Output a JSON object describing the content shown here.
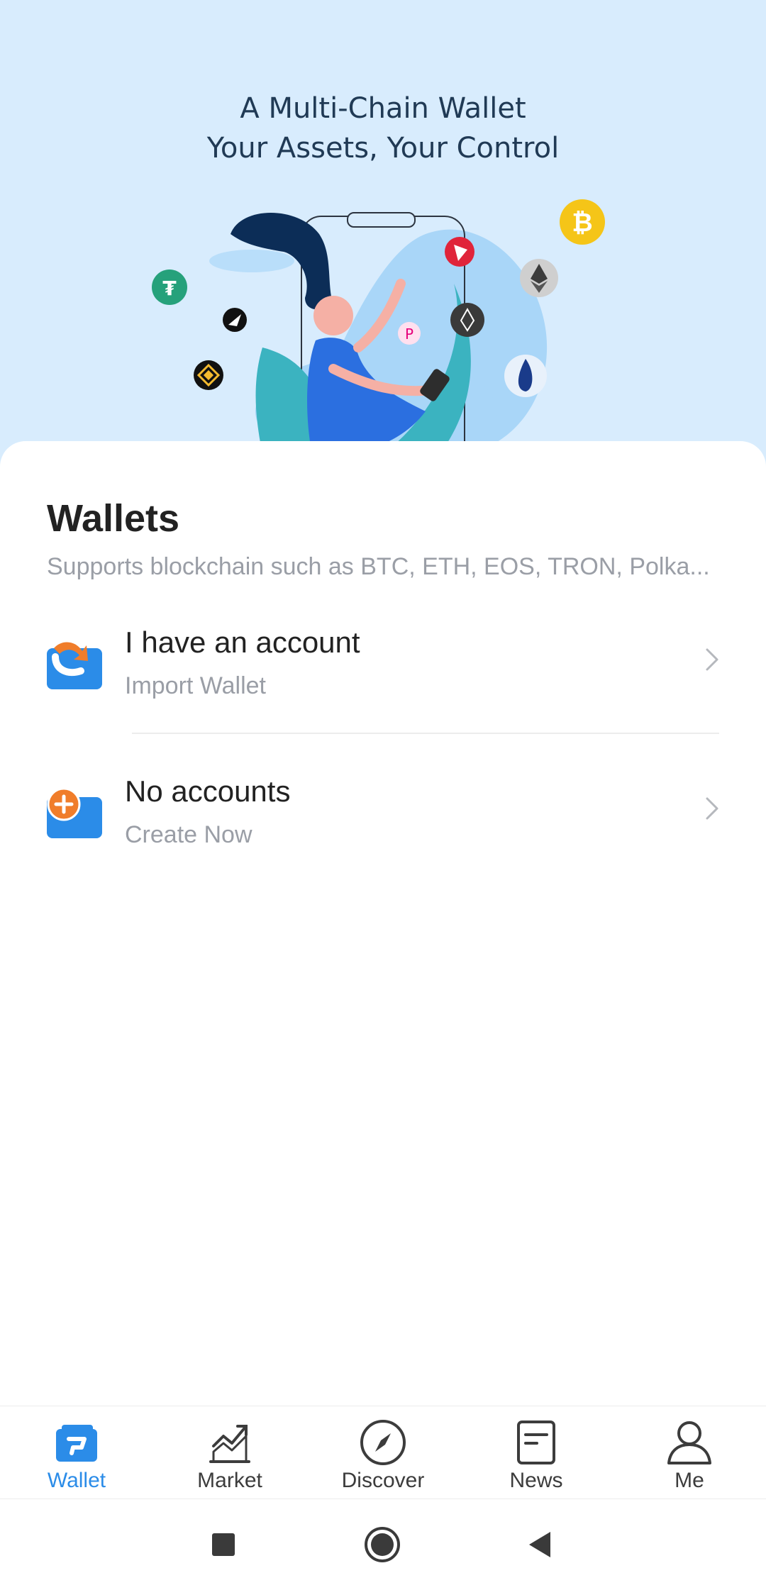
{
  "hero": {
    "title_line1": "A Multi-Chain Wallet",
    "title_line2": "Your Assets, Your Control",
    "coin_icons": [
      "bitcoin-icon",
      "ethereum-icon",
      "tron-icon",
      "eos-icon",
      "polkadot-icon",
      "huobi-icon",
      "tether-icon",
      "binance-icon",
      "navigation-coin-icon"
    ],
    "colors": {
      "background": "#d8ecfd",
      "title": "#203a55"
    }
  },
  "wallets": {
    "title": "Wallets",
    "subtitle": "Supports blockchain such as BTC, ETH, EOS, TRON, Polka..."
  },
  "options": [
    {
      "title": "I have an account",
      "subtitle": "Import Wallet",
      "icon": "import-wallet-icon"
    },
    {
      "title": "No accounts",
      "subtitle": "Create Now",
      "icon": "create-wallet-icon"
    }
  ],
  "tabs": [
    {
      "label": "Wallet",
      "icon": "wallet-icon",
      "active": true
    },
    {
      "label": "Market",
      "icon": "market-chart-icon",
      "active": false
    },
    {
      "label": "Discover",
      "icon": "compass-icon",
      "active": false
    },
    {
      "label": "News",
      "icon": "news-icon",
      "active": false
    },
    {
      "label": "Me",
      "icon": "person-icon",
      "active": false
    }
  ],
  "system_nav": [
    "recents-button",
    "home-button",
    "back-button"
  ],
  "colors": {
    "accent": "#2b8ce8",
    "orange": "#f07d2a",
    "muted_text": "#9a9ea6"
  }
}
